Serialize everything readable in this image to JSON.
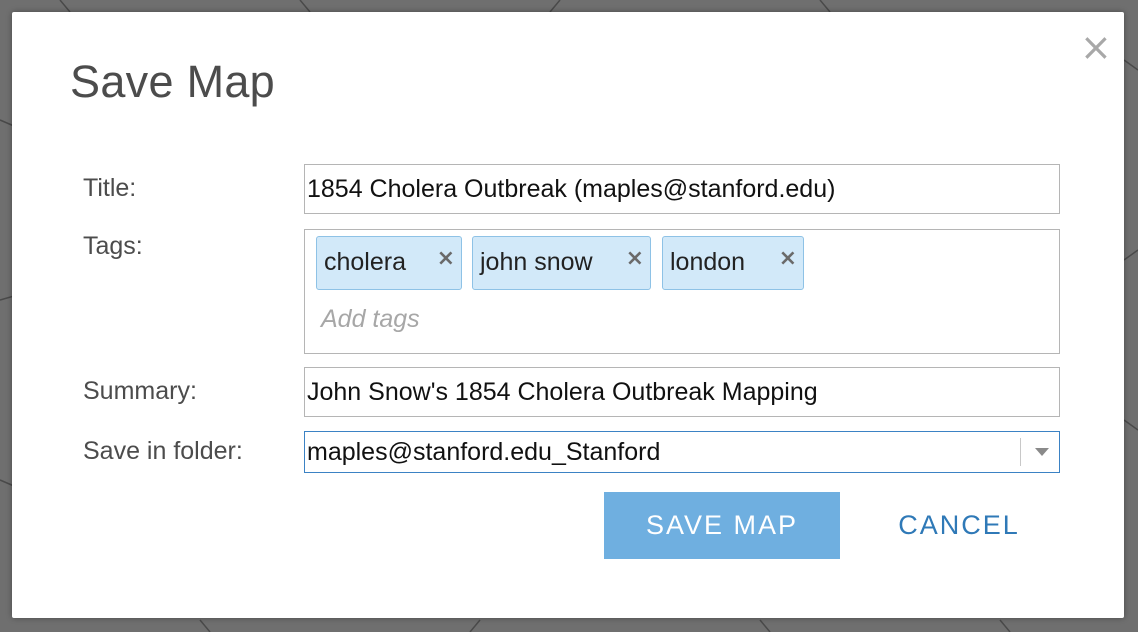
{
  "dialog": {
    "title": "Save Map",
    "close_icon": "close-icon",
    "close_glyph": "×"
  },
  "form": {
    "title_label": "Title:",
    "title_value": "1854 Cholera Outbreak (maples@stanford.edu)",
    "tags_label": "Tags:",
    "tags": [
      {
        "label": "cholera"
      },
      {
        "label": "john snow"
      },
      {
        "label": "london"
      }
    ],
    "tag_remove_glyph": "×",
    "tags_placeholder": "Add tags",
    "summary_label": "Summary:",
    "summary_value": "John Snow's 1854 Cholera Outbreak Mapping",
    "folder_label": "Save in folder:",
    "folder_value": "maples@stanford.edu_Stanford"
  },
  "actions": {
    "save_label": "SAVE MAP",
    "cancel_label": "CANCEL"
  },
  "colors": {
    "primary_button": "#6fafe0",
    "cancel_link": "#2f79b7",
    "tag_bg": "#d2e9f9",
    "tag_border": "#8ec2e6",
    "select_focus_border": "#3b82c4"
  }
}
